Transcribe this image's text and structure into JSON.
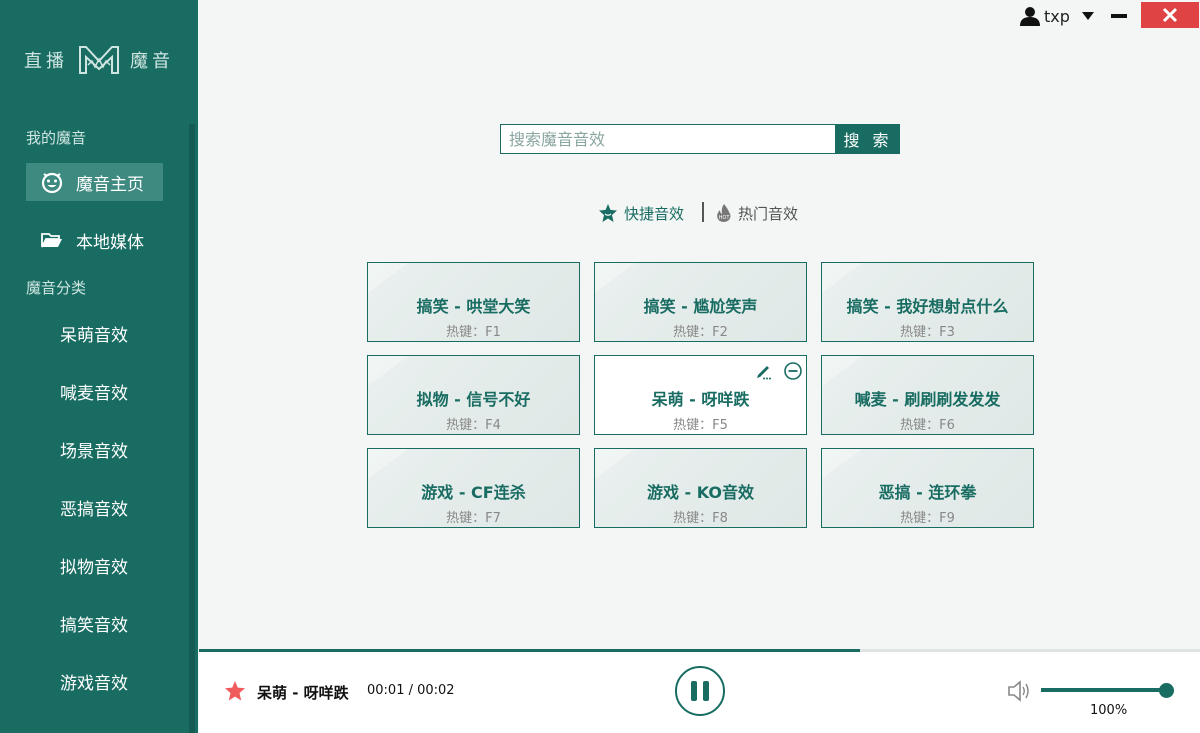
{
  "app": {
    "logo_left": "直播",
    "logo_right": "魔音"
  },
  "sidebar": {
    "my_section": "我的魔音",
    "nav": [
      {
        "label": "魔音主页",
        "icon": "face-icon",
        "active": true
      },
      {
        "label": "本地媒体",
        "icon": "folder-open-icon",
        "active": false
      }
    ],
    "category_section": "魔音分类",
    "categories": [
      "呆萌音效",
      "喊麦音效",
      "场景音效",
      "恶搞音效",
      "拟物音效",
      "搞笑音效",
      "游戏音效"
    ]
  },
  "topbar": {
    "username": "txp"
  },
  "search": {
    "placeholder": "搜索魔音音效",
    "button_label": "搜 索"
  },
  "tabs": [
    {
      "label": "快捷音效",
      "icon": "star-badge-icon",
      "active": true
    },
    {
      "label": "热门音效",
      "icon": "hot-flame-icon",
      "active": false
    }
  ],
  "cards": [
    {
      "title": "搞笑 - 哄堂大笑",
      "hotkey": "热键：F1"
    },
    {
      "title": "搞笑 - 尴尬笑声",
      "hotkey": "热键：F2"
    },
    {
      "title": "搞笑 - 我好想射点什么",
      "hotkey": "热键：F3"
    },
    {
      "title": "拟物 - 信号不好",
      "hotkey": "热键：F4"
    },
    {
      "title": "呆萌 - 呀咩跌",
      "hotkey": "热键：F5",
      "active": true
    },
    {
      "title": "喊麦 - 刷刷刷发发发",
      "hotkey": "热键：F6"
    },
    {
      "title": "游戏 - CF连杀",
      "hotkey": "热键：F7"
    },
    {
      "title": "游戏 - KO音效",
      "hotkey": "热键：F8"
    },
    {
      "title": "恶搞 - 连环拳",
      "hotkey": "热键：F9"
    }
  ],
  "player": {
    "title": "呆萌 - 呀咩跌",
    "time": "00:01 / 00:02",
    "progress_fraction": 0.66,
    "volume_label": "100%",
    "volume_fraction": 1.0
  },
  "colors": {
    "primary": "#186c62",
    "close": "#e04343",
    "star": "#f05b5b"
  }
}
